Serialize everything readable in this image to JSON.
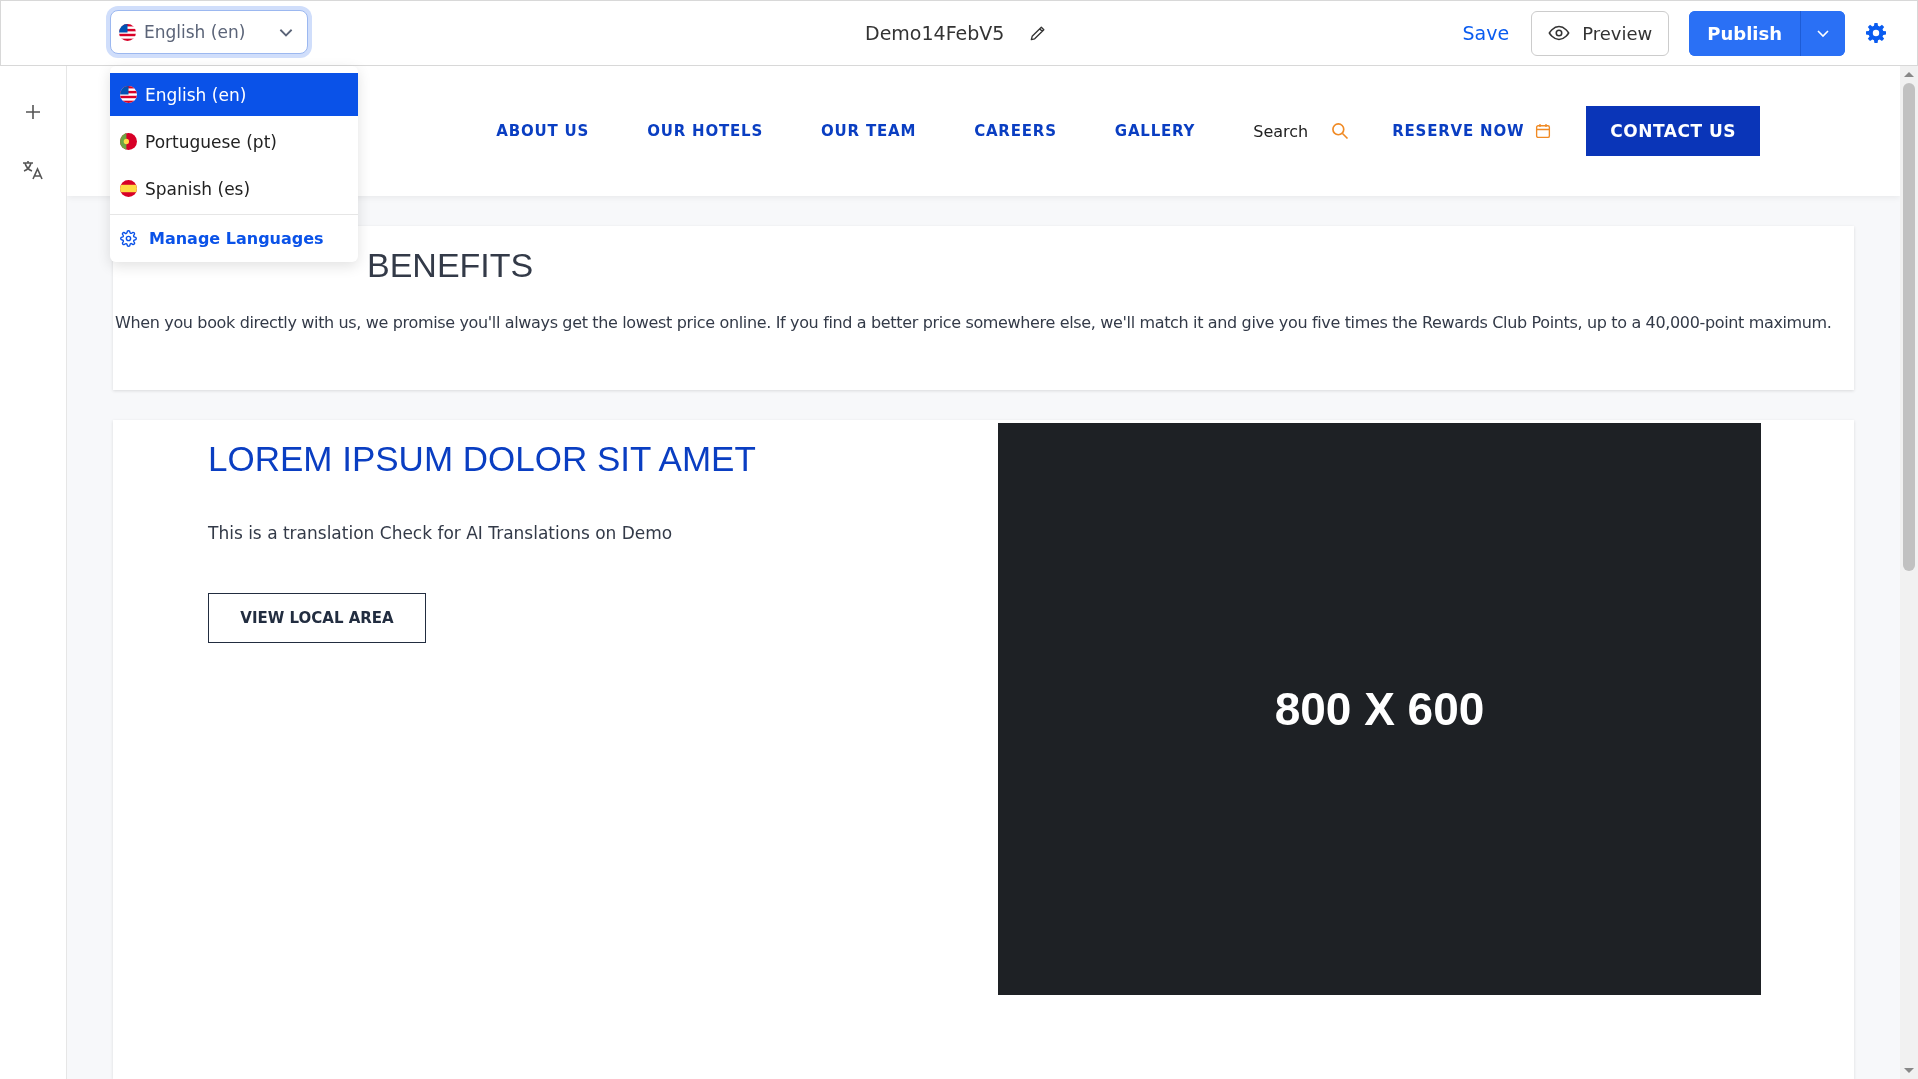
{
  "language_select": {
    "kind": "us",
    "value": "English (en)",
    "open": true
  },
  "language_menu": {
    "items": [
      {
        "kind": "us",
        "label": "English (en)",
        "selected": true
      },
      {
        "kind": "pt",
        "label": "Portuguese (pt)",
        "selected": false
      },
      {
        "kind": "es",
        "label": "Spanish (es)",
        "selected": false
      }
    ],
    "manage": "Manage Languages"
  },
  "page_title": "Demo14FebV5",
  "toolbar": {
    "save": "Save",
    "preview": "Preview",
    "publish": "Publish"
  },
  "side_tools": [
    {
      "kind": "add"
    },
    {
      "kind": "translate"
    }
  ],
  "site_nav": {
    "items": [
      {
        "kind": "link",
        "label": "ABOUT US"
      },
      {
        "kind": "link",
        "label": "OUR HOTELS"
      },
      {
        "kind": "link",
        "label": "OUR TEAM"
      },
      {
        "kind": "link",
        "label": "CAREERS"
      },
      {
        "kind": "link",
        "label": "GALLERY"
      },
      {
        "kind": "search",
        "label": "Search"
      },
      {
        "kind": "reserve",
        "label": "RESERVE NOW"
      }
    ],
    "cta": "CONTACT US"
  },
  "benefits": {
    "heading": "BENEFITS",
    "text": "When you book directly with us, we promise you'll always get the lowest price online. If you find a better price somewhere else, we'll match it and give you five times the Rewards Club Points, up to a 40,000-point maximum."
  },
  "feature": {
    "heading": "LOREM IPSUM DOLOR SIT AMET",
    "text": "This is a translation Check for AI Translations on Demo",
    "button": "VIEW LOCAL AREA",
    "image_label": "800 X 600"
  }
}
